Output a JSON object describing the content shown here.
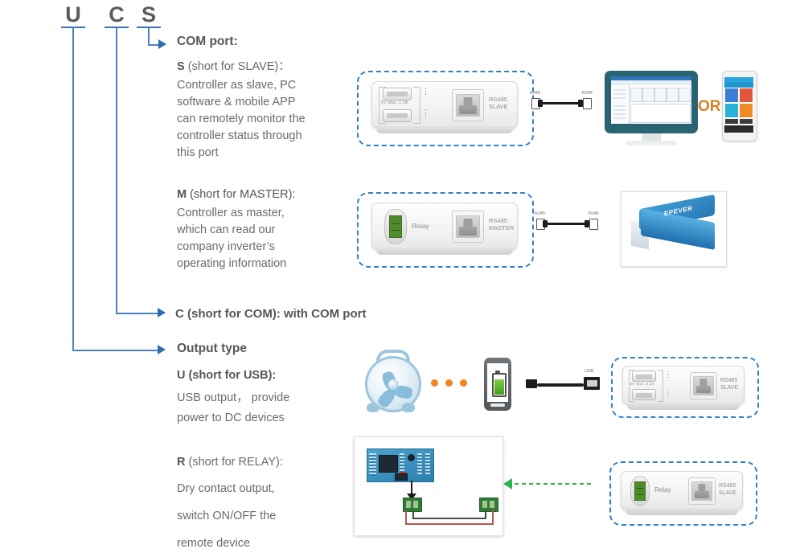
{
  "model_code": {
    "letters": [
      {
        "id": "U",
        "label": "U"
      },
      {
        "id": "C",
        "label": "C"
      },
      {
        "id": "S",
        "label": "S"
      }
    ]
  },
  "sections": {
    "com_port": {
      "heading": "COM port:",
      "slave": {
        "title_bold": "S ",
        "title_rest": "(short for SLAVE)：",
        "body_lines": [
          "Controller as slave, PC",
          "software & mobile APP",
          "can remotely monitor the",
          "controller status through",
          "this port"
        ]
      },
      "master": {
        "title_bold": "M ",
        "title_rest": "(short for MASTER):",
        "body_lines": [
          "Controller as master,",
          "which can read our",
          "company inverter’s",
          "operating information"
        ]
      }
    },
    "com_line": {
      "bold": "C ",
      "rest": "(short for COM): with COM port"
    },
    "output_type": {
      "heading": "Output type",
      "usb": {
        "title_bold": "U ",
        "title_rest": "(short for USB):",
        "body_lines": [
          "USB output， provide",
          "power to DC devices"
        ]
      },
      "relay": {
        "title_bold": "R ",
        "title_rest": "(short for RELAY):",
        "body_lines": [
          "Dry contact output,",
          "switch ON/OFF the",
          "remote device"
        ]
      }
    }
  },
  "devices": {
    "slave_controller": {
      "usb_rating": "5V   Max. 2.2A",
      "port_label_line1": "RS485",
      "port_label_line2": "SLAVE"
    },
    "master_controller": {
      "relay_label": "Relay",
      "port_label_line1": "RS485",
      "port_label_line2": "MASTER"
    },
    "usb_controller": {
      "usb_rating": "5V   Max. 2.2A",
      "port_label_line1": "RS485",
      "port_label_line2": "SLAVE"
    },
    "relay_controller": {
      "relay_label": "Relay",
      "port_label_line1": "RS485",
      "port_label_line2": "SLAVE"
    },
    "inverter": {
      "brand": "EPEVER"
    }
  },
  "cables": {
    "rj45_cable_1": {
      "left_tag": "RJ45",
      "right_tag": "RJ45"
    },
    "rj45_cable_2": {
      "left_tag": "RJ45",
      "right_tag": "RJ45"
    },
    "usb_cable": {
      "tag": "USB"
    }
  },
  "misc": {
    "or_label": "OR"
  },
  "colors": {
    "line_blue": "#4b82bd",
    "arrow_blue": "#2f6cad",
    "dash_border": "#2f7fc9",
    "text_gray": "#6b6b6b",
    "heading_gray": "#565656",
    "orange": "#ef8521",
    "or_orange": "#d9821e",
    "green_arrow": "#2bb24c",
    "relay_green": "#4f8b2a"
  }
}
